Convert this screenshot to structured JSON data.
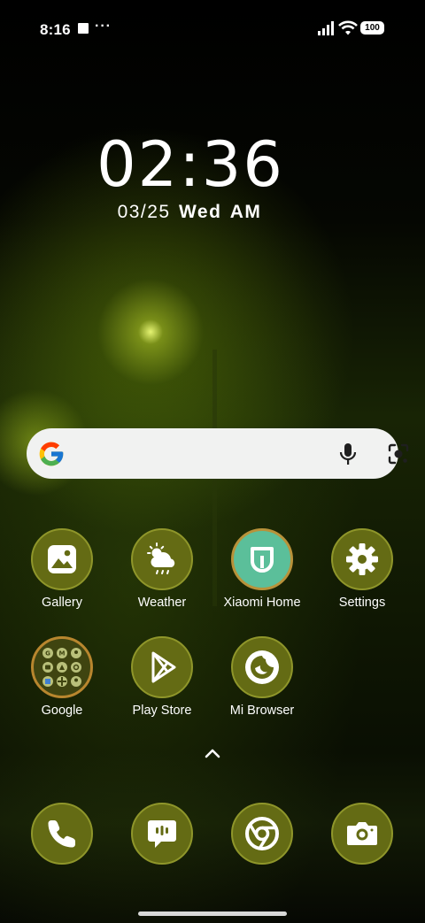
{
  "status_bar": {
    "time": "8:16",
    "notification_dots": "···",
    "battery": "100"
  },
  "clock": {
    "time": "02:36",
    "date": "03/25",
    "weekday": "Wed",
    "meridiem": "AM"
  },
  "search_bar": {
    "logo": "google-g-icon",
    "voice": "microphone-icon",
    "lens": "camera-lens-icon"
  },
  "apps_row1": [
    {
      "label": "Gallery",
      "icon": "gallery-icon"
    },
    {
      "label": "Weather",
      "icon": "weather-icon"
    },
    {
      "label": "Xiaomi Home",
      "icon": "xiaomi-home-icon"
    },
    {
      "label": "Settings",
      "icon": "settings-gear-icon"
    }
  ],
  "apps_row2": [
    {
      "label": "Google",
      "icon": "google-folder-icon"
    },
    {
      "label": "Play Store",
      "icon": "play-store-icon"
    },
    {
      "label": "Mi Browser",
      "icon": "mi-browser-icon"
    }
  ],
  "dock": [
    {
      "icon": "phone-icon"
    },
    {
      "icon": "messages-icon"
    },
    {
      "icon": "chrome-icon"
    },
    {
      "icon": "camera-icon"
    }
  ],
  "colors": {
    "icon_bg": "#646b14",
    "icon_ring": "#8f962a",
    "xiaomi_home_bg": "#5bbf9a",
    "search_bg": "#f1f2f1"
  }
}
